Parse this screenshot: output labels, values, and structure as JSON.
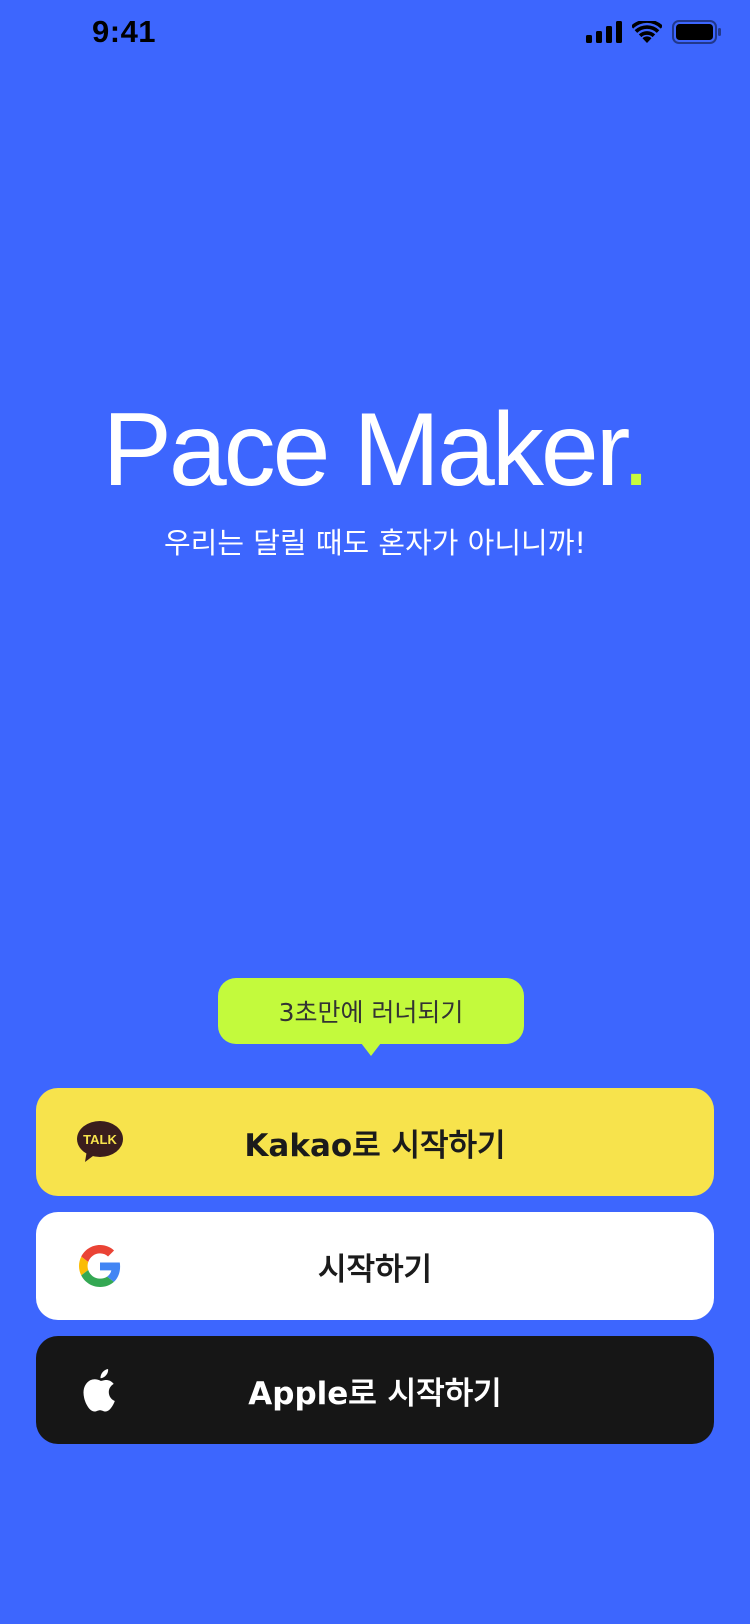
{
  "status_bar": {
    "time": "9:41"
  },
  "brand": {
    "name": "Pace Maker",
    "dot": ".",
    "tagline": "우리는 달릴 때도 혼자가 아니니까!",
    "accent_color": "#c6fb3d",
    "background_color": "#3d66fe"
  },
  "tooltip": {
    "text": "3초만에 러너되기"
  },
  "login": {
    "kakao": {
      "label": "Kakao로 시작하기",
      "icon": "kakao-talk-icon",
      "badge_text": "TALK"
    },
    "google": {
      "label": "시작하기",
      "icon": "google-icon"
    },
    "apple": {
      "label": "Apple로 시작하기",
      "icon": "apple-icon"
    }
  }
}
